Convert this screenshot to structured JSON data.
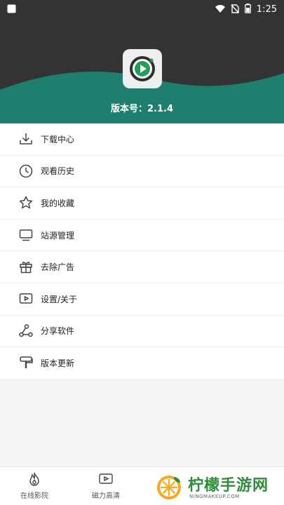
{
  "status_bar": {
    "time": "1:25",
    "icons": [
      "square-notification-icon",
      "wifi-icon",
      "no-sim-icon",
      "battery-icon"
    ]
  },
  "header": {
    "version_text": "版本号：2.1.4",
    "app_icon": "play-button-icon"
  },
  "menu": {
    "items": [
      {
        "label": "下载中心",
        "icon": "download-icon"
      },
      {
        "label": "观看历史",
        "icon": "clock-icon"
      },
      {
        "label": "我的收藏",
        "icon": "star-icon"
      },
      {
        "label": "站源管理",
        "icon": "monitor-icon"
      },
      {
        "label": "去除广告",
        "icon": "gift-icon"
      },
      {
        "label": "设置/关于",
        "icon": "play-box-icon"
      },
      {
        "label": "分享软件",
        "icon": "share-icon"
      },
      {
        "label": "版本更新",
        "icon": "brush-icon"
      }
    ]
  },
  "bottom_nav": {
    "items": [
      {
        "label": "在线影院",
        "icon": "flame-icon"
      },
      {
        "label": "磁力高清",
        "icon": "play-box-icon"
      }
    ]
  },
  "watermark": {
    "title": "柠檬手游网",
    "subtitle": "NINGMAKEUP.COM"
  },
  "colors": {
    "header_dark": "#333333",
    "teal": "#1e7f6e",
    "icon_green": "#1f9e5a"
  }
}
